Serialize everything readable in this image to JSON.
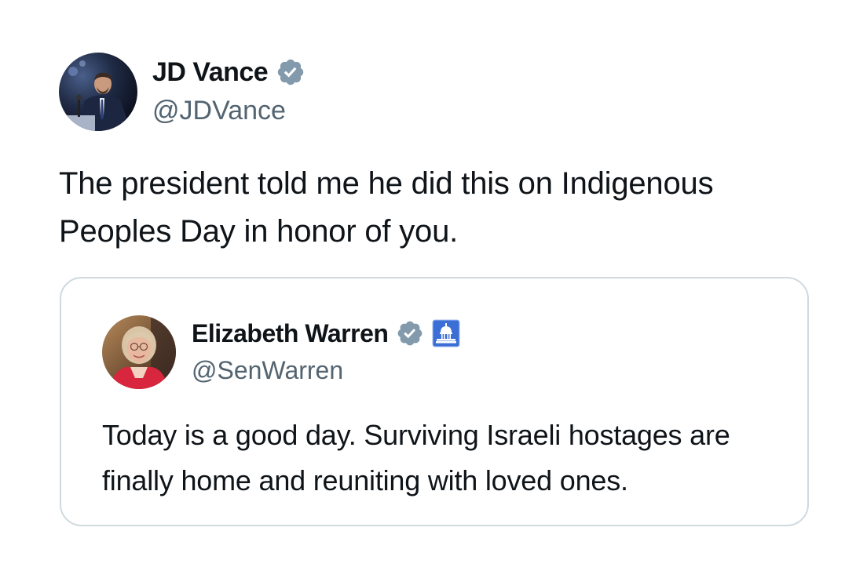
{
  "tweet": {
    "author": {
      "name": "JD Vance",
      "handle": "@JDVance",
      "verified_badge_icon": "verified-badge-icon",
      "verified_badge_color": "#829aab"
    },
    "text": "The president told me he did this on Indigenous Peoples Day in honor of you.",
    "quoted_tweet": {
      "author": {
        "name": "Elizabeth Warren",
        "handle": "@SenWarren",
        "verified_badge_icon": "verified-badge-icon",
        "verified_badge_color": "#829aab",
        "affiliation_icon": "capitol-building-icon",
        "affiliation_color": "#3b6fd6"
      },
      "text": "Today is a good day. Surviving Israeli hostages are finally home and reuniting with loved ones."
    }
  },
  "colors": {
    "text_primary": "#0f1419",
    "text_secondary": "#536471",
    "card_border": "#cfd9de",
    "background": "#ffffff"
  }
}
